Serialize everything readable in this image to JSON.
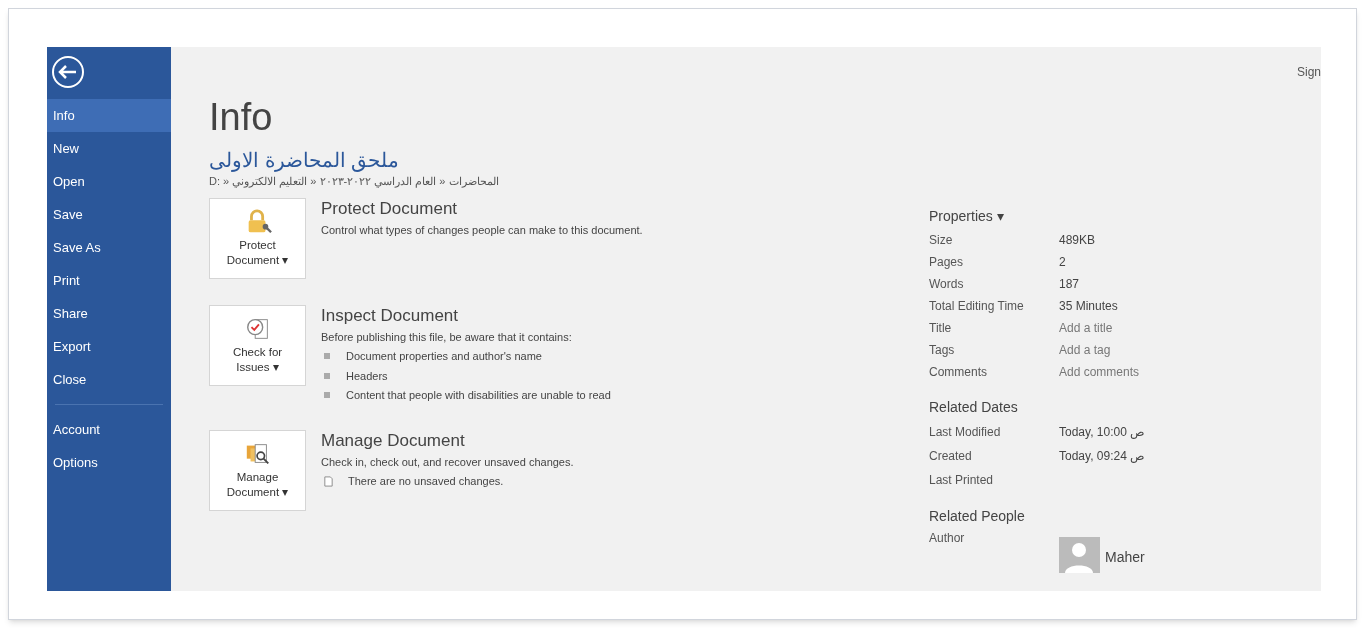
{
  "sidebar": {
    "groups": [
      [
        {
          "label": "Info",
          "selected": true
        },
        {
          "label": "New",
          "selected": false
        },
        {
          "label": "Open",
          "selected": false
        },
        {
          "label": "Save",
          "selected": false
        },
        {
          "label": "Save As",
          "selected": false
        },
        {
          "label": "Print",
          "selected": false
        },
        {
          "label": "Share",
          "selected": false
        },
        {
          "label": "Export",
          "selected": false
        },
        {
          "label": "Close",
          "selected": false
        }
      ],
      [
        {
          "label": "Account",
          "selected": false
        },
        {
          "label": "Options",
          "selected": false
        }
      ]
    ]
  },
  "sign_in": "Sign",
  "page_title": "Info",
  "document": {
    "name": "ملحق المحاضرة الاولى",
    "path": "المحاضرات « العام الدراسي ٢٠٢٢-٢٠٢٣ « التعليم الالكتروني « :D"
  },
  "sections": [
    {
      "kind": "protect",
      "button": [
        "Protect",
        "Document ▾"
      ],
      "title": "Protect Document",
      "description": "Control what types of changes people can make to this document."
    },
    {
      "kind": "inspect",
      "button": [
        "Check for",
        "Issues ▾"
      ],
      "title": "Inspect Document",
      "description": "Before publishing this file, be aware that it contains:",
      "bullets": [
        "Document properties and author's name",
        "Headers",
        "Content that people with disabilities are unable to read"
      ]
    },
    {
      "kind": "manage",
      "button": [
        "Manage",
        "Document ▾"
      ],
      "title": "Manage Document",
      "description": "Check in, check out, and recover unsaved changes.",
      "note": "There are no unsaved changes."
    }
  ],
  "properties": {
    "heading": "Properties ▾",
    "rows": [
      {
        "label": "Size",
        "value": "489KB",
        "kind": "value"
      },
      {
        "label": "Pages",
        "value": "2",
        "kind": "value"
      },
      {
        "label": "Words",
        "value": "187",
        "kind": "value"
      },
      {
        "label": "Total Editing Time",
        "value": "35 Minutes",
        "kind": "value"
      },
      {
        "label": "Title",
        "placeholder": "Add a title",
        "kind": "input"
      },
      {
        "label": "Tags",
        "placeholder": "Add a tag",
        "kind": "input"
      },
      {
        "label": "Comments",
        "placeholder": "Add comments",
        "kind": "input"
      }
    ]
  },
  "related_dates": {
    "heading": "Related Dates",
    "rows": [
      {
        "label": "Last Modified",
        "value": "Today, 10:00 ص"
      },
      {
        "label": "Created",
        "value": "Today, 09:24 ص"
      },
      {
        "label": "Last Printed"
      }
    ]
  },
  "related_people": {
    "heading": "Related People",
    "label": "Author",
    "author": "Maher"
  }
}
